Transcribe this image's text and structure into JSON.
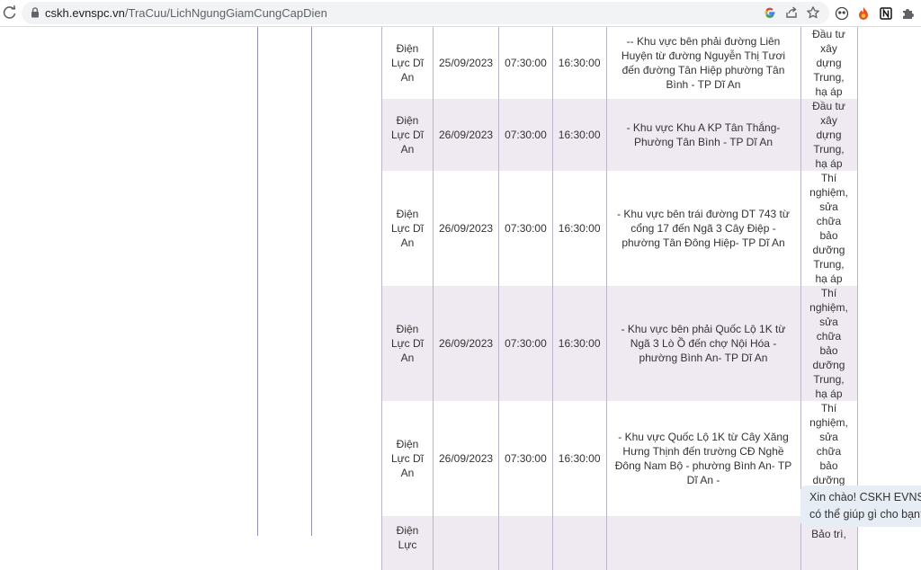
{
  "browser": {
    "url_host": "cskh.evnspc.vn",
    "url_path": "/TraCuu/LichNgungGiamCungCapDien"
  },
  "table": {
    "rows": [
      {
        "unit": "Điện Lực Dĩ An",
        "date": "25/09/2023",
        "start": "07:30:00",
        "end": "16:30:00",
        "area": "-- Khu vực bên phải đường Liên Huyện từ đường Nguyễn Thị Tươi đến đường Tân Hiệp phường Tân Bình - TP Dĩ An",
        "reason": "Đầu tư xây dựng Trung, hạ áp"
      },
      {
        "unit": "Điện Lực Dĩ An",
        "date": "26/09/2023",
        "start": "07:30:00",
        "end": "16:30:00",
        "area": "- Khu vực Khu A KP Tân Thắng-Phường Tân Bình - TP Dĩ An",
        "reason": "Đầu tư xây dựng Trung, hạ áp"
      },
      {
        "unit": "Điện Lực Dĩ An",
        "date": "26/09/2023",
        "start": "07:30:00",
        "end": "16:30:00",
        "area": "- Khu vực bên trái đường DT 743 từ cổng 17 đến Ngã 3 Cây Điệp - phường Tân Đông Hiệp- TP Dĩ An",
        "reason": "Thí nghiệm, sửa chữa bảo dưỡng Trung, hạ áp"
      },
      {
        "unit": "Điện Lực Dĩ An",
        "date": "26/09/2023",
        "start": "07:30:00",
        "end": "16:30:00",
        "area": "- Khu vực bên phải Quốc Lộ 1K từ Ngã 3 Lò Ồ đến chợ Nội Hóa - phường Bình An- TP Dĩ An",
        "reason": "Thí nghiệm, sửa chữa bảo dưỡng Trung, hạ áp"
      },
      {
        "unit": "Điện Lực Dĩ An",
        "date": "26/09/2023",
        "start": "07:30:00",
        "end": "16:30:00",
        "area": "- Khu vực Quốc Lộ 1K từ Cây Xăng Hưng Thịnh đến trường CĐ Nghề Đông Nam Bộ - phường Bình An- TP Dĩ An -",
        "reason": "Thí nghiệm, sửa chữa bảo dưỡng Trung, hạ áp"
      },
      {
        "unit": "Điện Lực",
        "date": "",
        "start": "",
        "end": "",
        "area": "",
        "reason": "Bảo trì,"
      }
    ]
  },
  "chat": {
    "line1": "Xin chào! CSKH EVNSPC",
    "line2": "có thể giúp gì cho bạn?"
  },
  "icons": {
    "reload": "reload-icon",
    "lock": "lock-icon",
    "google": "google-icon",
    "share": "share-icon",
    "bookmark": "star-icon"
  }
}
